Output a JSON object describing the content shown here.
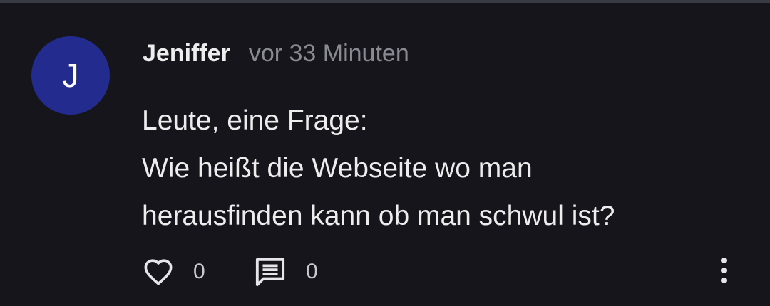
{
  "comment": {
    "avatar_initial": "J",
    "avatar_color": "#232c8e",
    "author": "Jeniffer",
    "timestamp": "vor 33 Minuten",
    "body_lines": [
      "Leute, eine Frage:",
      "Wie heißt die Webseite wo man",
      "herausfinden kann ob man schwul ist?"
    ],
    "actions": {
      "like_icon": "heart-outline-icon",
      "like_count": "0",
      "reply_icon": "comment-icon",
      "reply_count": "0",
      "more_icon": "more-vertical-icon"
    }
  }
}
